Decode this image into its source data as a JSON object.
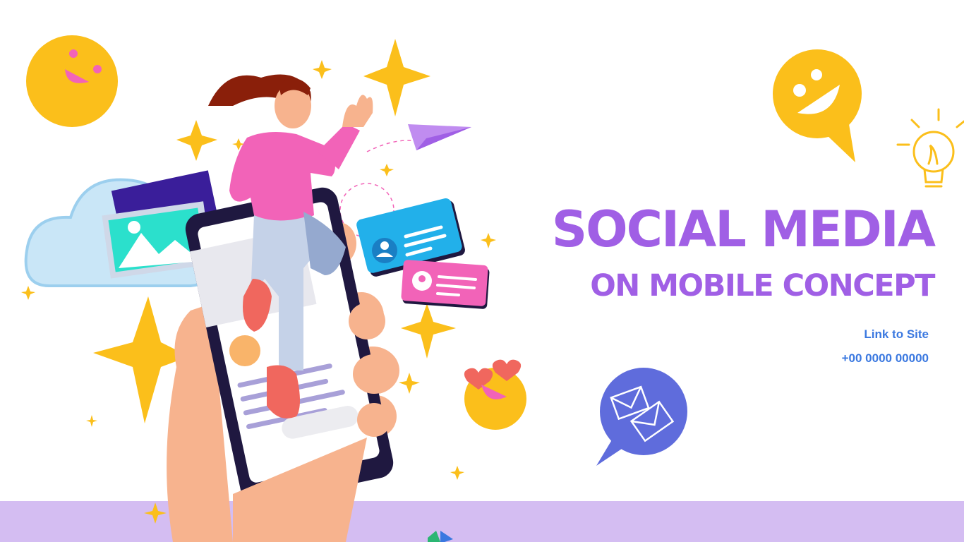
{
  "headline": {
    "line1": "SOCIAL MEDIA",
    "line2": "ON MOBILE CONCEPT"
  },
  "contact": {
    "link_label": "Link to Site",
    "phone": "+00 0000 00000"
  },
  "colors": {
    "accent_purple": "#a05fe5",
    "link_blue": "#3a78e0",
    "band_lavender": "#d4bdf2",
    "star_yellow": "#fbbf1b",
    "shirt_pink": "#f263b8",
    "phone_navy": "#1f1840",
    "skin": "#f7b38e"
  },
  "icons": [
    "smiley-icon",
    "smiley-speech-bubble-icon",
    "lightbulb-icon",
    "heart-eyes-emoji-icon",
    "mail-bubble-icon",
    "paper-plane-icon",
    "cloud-icon",
    "photo-icon",
    "profile-card-icon",
    "sparkle-icon"
  ]
}
